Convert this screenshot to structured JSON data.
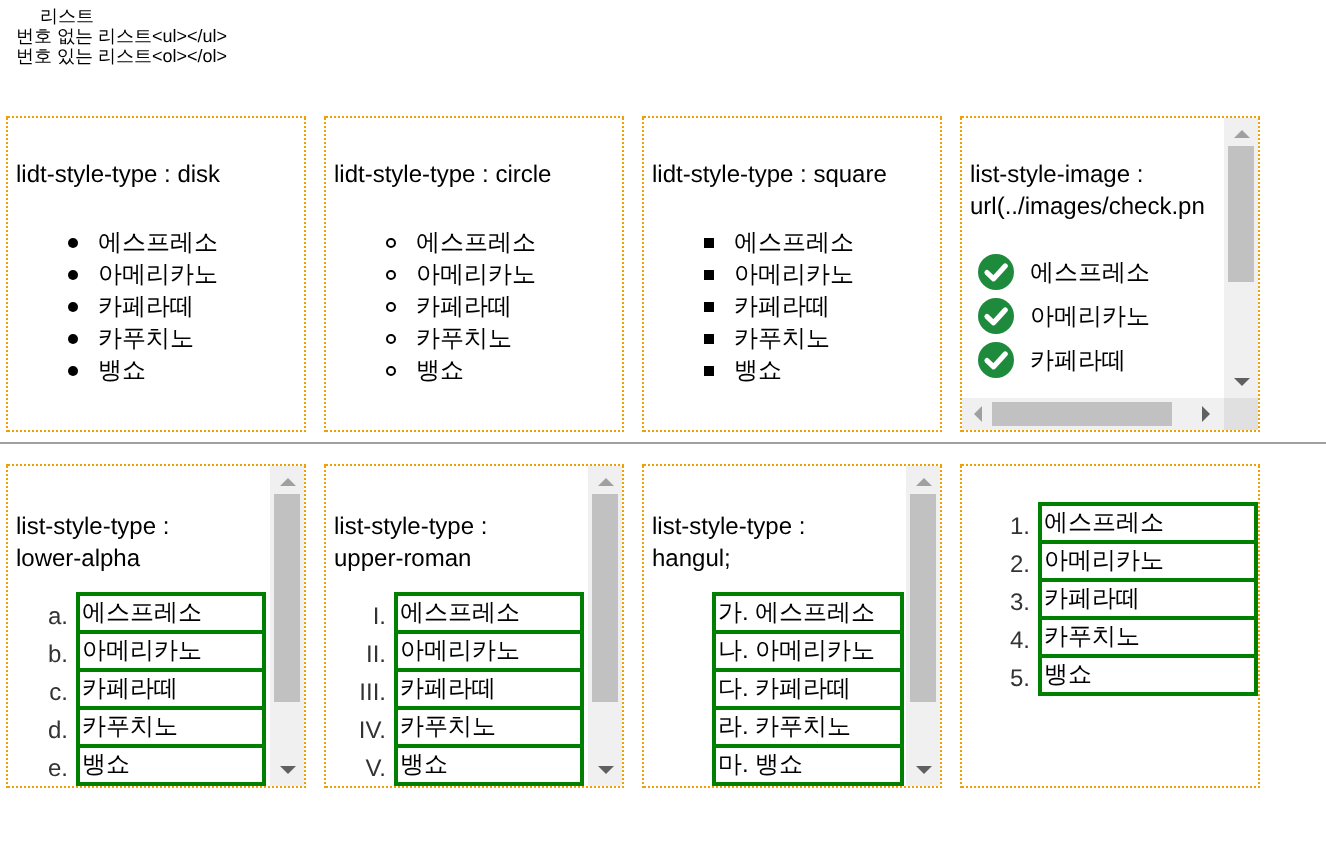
{
  "header": {
    "lines": [
      "리스트",
      "번호 없는 리스트<ul></ul>",
      "번호 있는 리스트<ol></ol>"
    ]
  },
  "rows": [
    {
      "boxes": [
        {
          "heading": [
            "lidt-style-type : disk"
          ],
          "kind": "disk",
          "boxed": false,
          "items": [
            {
              "text": "에스프레소"
            },
            {
              "text": "아메리카노"
            },
            {
              "text": "카페라떼"
            },
            {
              "text": "카푸치노"
            },
            {
              "text": "뱅쇼"
            }
          ]
        },
        {
          "heading": [
            "lidt-style-type : circle"
          ],
          "kind": "circle",
          "boxed": false,
          "items": [
            {
              "text": "에스프레소"
            },
            {
              "text": "아메리카노"
            },
            {
              "text": "카페라떼"
            },
            {
              "text": "카푸치노"
            },
            {
              "text": "뱅쇼"
            }
          ]
        },
        {
          "heading": [
            "lidt-style-type : square"
          ],
          "kind": "square",
          "boxed": false,
          "items": [
            {
              "text": "에스프레소"
            },
            {
              "text": "아메리카노"
            },
            {
              "text": "카페라떼"
            },
            {
              "text": "카푸치노"
            },
            {
              "text": "뱅쇼"
            }
          ]
        },
        {
          "heading": [
            "list-style-image :",
            "url(../images/check.pn"
          ],
          "kind": "image",
          "boxed": false,
          "vertical_scrollbar": true,
          "horizontal_scrollbar": true,
          "items": [
            {
              "text": "에스프레소"
            },
            {
              "text": "아메리카노"
            },
            {
              "text": "카페라떼"
            }
          ]
        }
      ]
    },
    {
      "boxes": [
        {
          "heading": [
            "list-style-type :",
            "lower-alpha"
          ],
          "kind": "text",
          "boxed": true,
          "vertical_scrollbar": true,
          "items": [
            {
              "marker": "a.",
              "text": "에스프레소"
            },
            {
              "marker": "b.",
              "text": "아메리카노"
            },
            {
              "marker": "c.",
              "text": "카페라떼"
            },
            {
              "marker": "d.",
              "text": "카푸치노"
            },
            {
              "marker": "e.",
              "text": "뱅쇼"
            }
          ]
        },
        {
          "heading": [
            "list-style-type :",
            "upper-roman"
          ],
          "kind": "text",
          "boxed": true,
          "vertical_scrollbar": true,
          "items": [
            {
              "marker": "I.",
              "text": "에스프레소"
            },
            {
              "marker": "II.",
              "text": "아메리카노"
            },
            {
              "marker": "III.",
              "text": "카페라떼"
            },
            {
              "marker": "IV.",
              "text": "카푸치노"
            },
            {
              "marker": "V.",
              "text": "뱅쇼"
            }
          ]
        },
        {
          "heading": [
            "list-style-type :",
            "hangul;"
          ],
          "kind": "inside",
          "boxed": true,
          "vertical_scrollbar": true,
          "items": [
            {
              "text": "가. 에스프레소"
            },
            {
              "text": "나. 아메리카노"
            },
            {
              "text": "다. 카페라떼"
            },
            {
              "text": "라. 카푸치노"
            },
            {
              "text": "마. 뱅쇼"
            }
          ]
        },
        {
          "kind": "text",
          "boxed": true,
          "items": [
            {
              "marker": "1.",
              "text": "에스프레소"
            },
            {
              "marker": "2.",
              "text": "아메리카노"
            },
            {
              "marker": "3.",
              "text": "카페라떼"
            },
            {
              "marker": "4.",
              "text": "카푸치노"
            },
            {
              "marker": "5.",
              "text": "뱅쇼"
            }
          ]
        }
      ]
    }
  ]
}
